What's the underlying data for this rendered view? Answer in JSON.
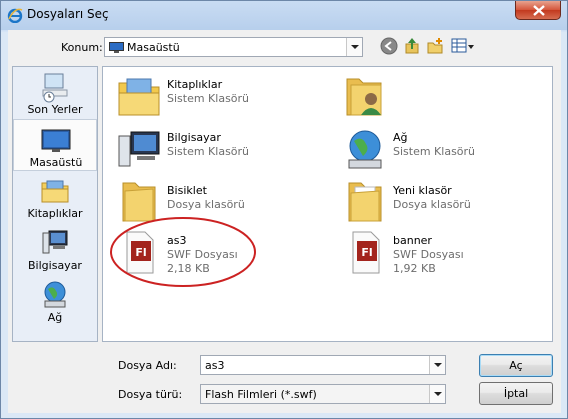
{
  "window": {
    "title": "Dosyaları Seç"
  },
  "toolbar": {
    "location_label": "Konum:",
    "location_value": "Masaüstü"
  },
  "places": [
    {
      "label": "Son Yerler",
      "icon": "recent-places-icon"
    },
    {
      "label": "Masaüstü",
      "icon": "desktop-icon",
      "selected": true
    },
    {
      "label": "Kitaplıklar",
      "icon": "libraries-icon"
    },
    {
      "label": "Bilgisayar",
      "icon": "computer-icon"
    },
    {
      "label": "Ağ",
      "icon": "network-icon"
    }
  ],
  "files": [
    {
      "name": "Kitaplıklar",
      "type": "Sistem Klasörü",
      "size": "",
      "icon": "libraries-icon"
    },
    {
      "name": "",
      "type": "",
      "size": "",
      "icon": "user-folder-icon"
    },
    {
      "name": "Bilgisayar",
      "type": "Sistem Klasörü",
      "size": "",
      "icon": "computer-icon"
    },
    {
      "name": "Ağ",
      "type": "Sistem Klasörü",
      "size": "",
      "icon": "network-icon"
    },
    {
      "name": "Bisiklet",
      "type": "Dosya klasörü",
      "size": "",
      "icon": "folder-icon"
    },
    {
      "name": "Yeni klasör",
      "type": "Dosya klasörü",
      "size": "",
      "icon": "folder-icon"
    },
    {
      "name": "as3",
      "type": "SWF Dosyası",
      "size": "2,18 KB",
      "icon": "flash-file-icon"
    },
    {
      "name": "banner",
      "type": "SWF Dosyası",
      "size": "1,92 KB",
      "icon": "flash-file-icon"
    }
  ],
  "bottom": {
    "filename_label": "Dosya Adı:",
    "filename_value": "as3",
    "filetype_label": "Dosya türü:",
    "filetype_value": "Flash Filmleri (*.swf)",
    "open_label": "Aç",
    "cancel_label": "İptal"
  },
  "colors": {
    "annotation": "#cc2222",
    "flash_red": "#a3241d"
  }
}
